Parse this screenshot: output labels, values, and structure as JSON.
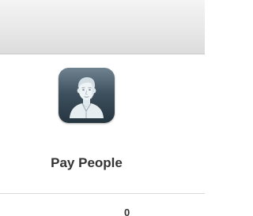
{
  "menu": {
    "pay_people": {
      "label": "Pay People",
      "icon": "person-portrait-icon"
    }
  },
  "below_divider": {
    "partial_text": "0"
  },
  "colors": {
    "icon_bg_top": "#5f7483",
    "icon_bg_bottom": "#253540",
    "label_text": "#333333",
    "header_bg": "#e8e8e8"
  }
}
